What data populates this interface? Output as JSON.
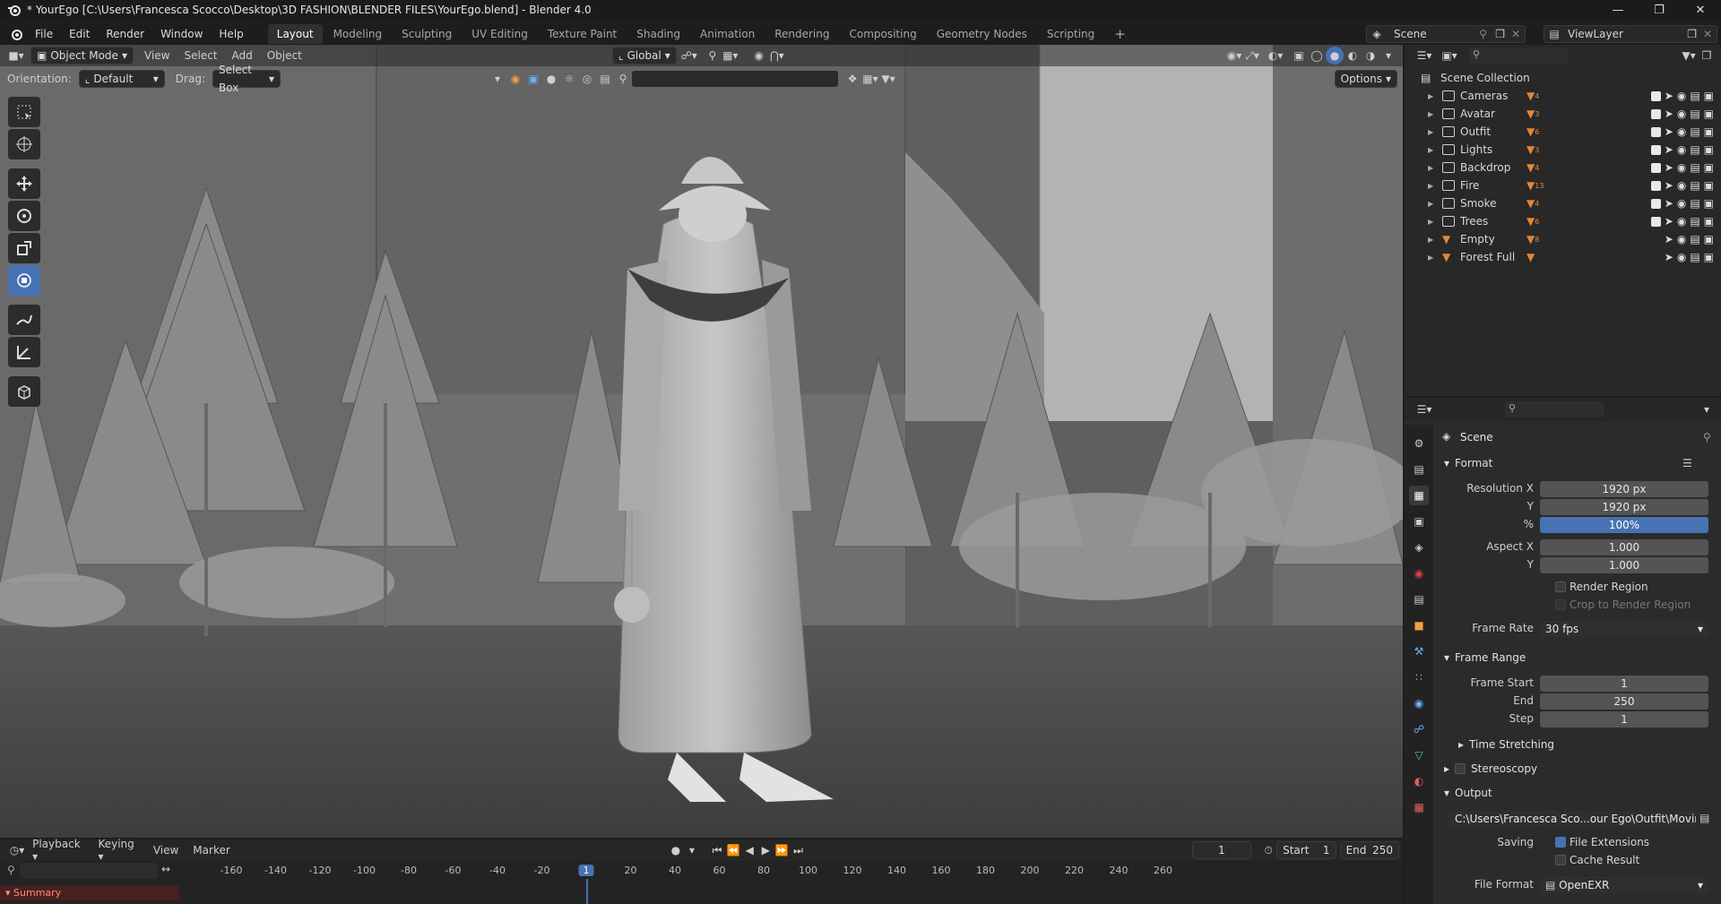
{
  "window": {
    "title": "* YourEgo [C:\\Users\\Francesca Scocco\\Desktop\\3D FASHION\\BLENDER FILES\\YourEgo.blend] - Blender 4.0"
  },
  "menus": [
    "File",
    "Edit",
    "Render",
    "Window",
    "Help"
  ],
  "workspaces": [
    "Layout",
    "Modeling",
    "Sculpting",
    "UV Editing",
    "Texture Paint",
    "Shading",
    "Animation",
    "Rendering",
    "Compositing",
    "Geometry Nodes",
    "Scripting"
  ],
  "scene_name": "Scene",
  "view_layer": "ViewLayer",
  "viewport": {
    "mode": "Object Mode",
    "menu": [
      "View",
      "Select",
      "Add",
      "Object"
    ],
    "transform_orientation": "Global",
    "orientation_label": "Orientation:",
    "orientation_value": "Default",
    "drag_label": "Drag:",
    "drag_value": "Select Box",
    "options": "Options"
  },
  "timeline": {
    "menu": [
      "Playback",
      "Keying",
      "View",
      "Marker"
    ],
    "current_frame": "1",
    "start_label": "Start",
    "start": "1",
    "end_label": "End",
    "end": "250",
    "ruler_ticks": [
      "-160",
      "-140",
      "-120",
      "-100",
      "-80",
      "-60",
      "-40",
      "-20",
      "1",
      "20",
      "40",
      "60",
      "80",
      "100",
      "120",
      "140",
      "160",
      "180",
      "200",
      "220",
      "240",
      "260"
    ],
    "summary": "Summary"
  },
  "outliner": {
    "root": "Scene Collection",
    "items": [
      {
        "name": "Cameras",
        "count": "4",
        "count2": "2"
      },
      {
        "name": "Avatar",
        "count": "3"
      },
      {
        "name": "Outfit",
        "count": "6"
      },
      {
        "name": "Lights",
        "count": "3"
      },
      {
        "name": "Backdrop",
        "count": "4"
      },
      {
        "name": "Fire",
        "count": "13"
      },
      {
        "name": "Smoke",
        "count": "4"
      },
      {
        "name": "Trees",
        "count": "6"
      },
      {
        "name": "Empty",
        "count": "8"
      },
      {
        "name": "Forest Full",
        "count": ""
      }
    ]
  },
  "properties": {
    "context": "Scene",
    "format_title": "Format",
    "resolution_x_label": "Resolution X",
    "resolution_x": "1920 px",
    "y_label": "Y",
    "resolution_y": "1920 px",
    "percent_label": "%",
    "percent": "100%",
    "aspect_x_label": "Aspect X",
    "aspect_x": "1.000",
    "aspect_y": "1.000",
    "render_region": "Render Region",
    "crop_region": "Crop to Render Region",
    "frame_rate_label": "Frame Rate",
    "frame_rate": "30 fps",
    "frame_range_title": "Frame Range",
    "frame_start_label": "Frame Start",
    "frame_start": "1",
    "end_label": "End",
    "frame_end": "250",
    "step_label": "Step",
    "step": "1",
    "time_stretching": "Time Stretching",
    "stereoscopy": "Stereoscopy",
    "output_title": "Output",
    "output_path": "C:\\Users\\Francesca Sco...our Ego\\Outfit\\Moving\\",
    "saving_label": "Saving",
    "file_extensions": "File Extensions",
    "cache_result": "Cache Result",
    "file_format_label": "File Format",
    "file_format": "OpenEXR"
  },
  "colors": {
    "accent": "#4772b3",
    "collection_orange": "#e0883a"
  }
}
